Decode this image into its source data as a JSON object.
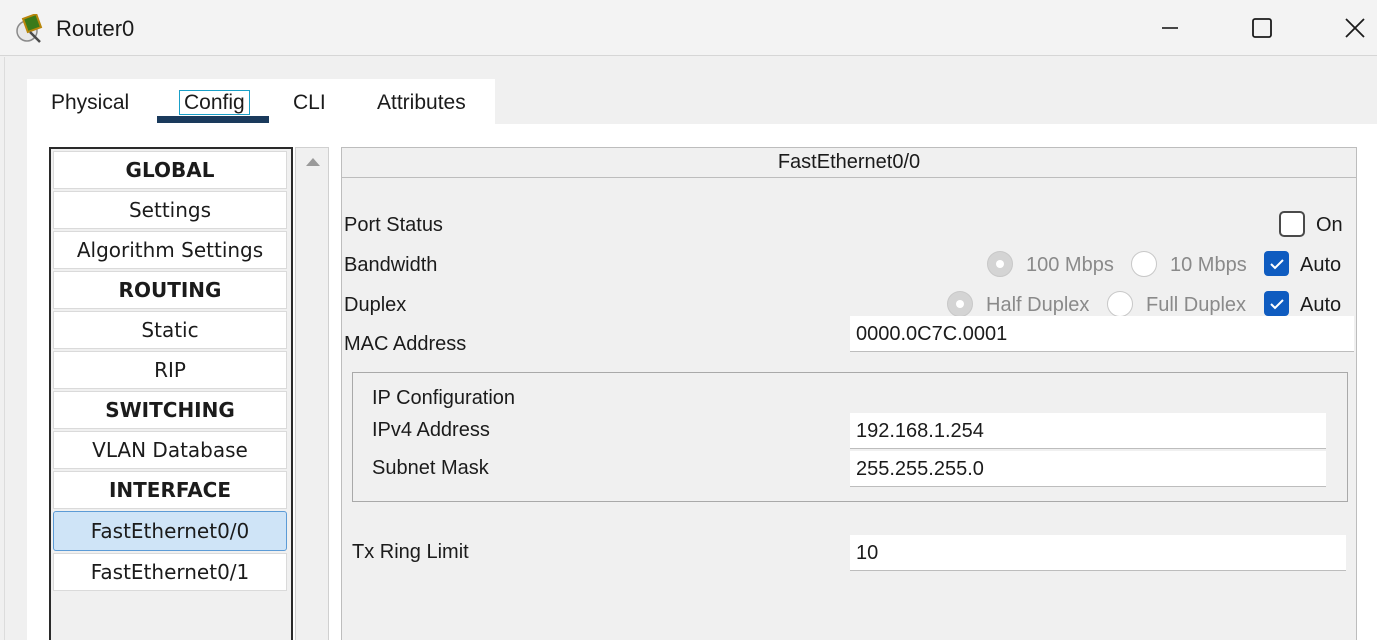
{
  "window": {
    "title": "Router0",
    "icon": "router-icon",
    "controls": [
      "minimize-icon",
      "maximize-icon",
      "close-icon"
    ]
  },
  "tabs": [
    {
      "label": "Physical"
    },
    {
      "label": "Config"
    },
    {
      "label": "CLI"
    },
    {
      "label": "Attributes"
    }
  ],
  "active_tab": "Config",
  "nav": {
    "global_header": "GLOBAL",
    "settings": "Settings",
    "algorithm_settings": "Algorithm Settings",
    "routing_header": "ROUTING",
    "static": "Static",
    "rip": "RIP",
    "switching_header": "SWITCHING",
    "vlan_database": "VLAN Database",
    "interface_header": "INTERFACE",
    "fa00": "FastEthernet0/0",
    "fa01": "FastEthernet0/1"
  },
  "panel": {
    "title": "FastEthernet0/0",
    "port_status": {
      "label": "Port Status",
      "on_label": "On",
      "on": false
    },
    "bandwidth": {
      "label": "Bandwidth",
      "opt_100": "100 Mbps",
      "opt_10": "10 Mbps",
      "auto_label": "Auto",
      "auto": true
    },
    "duplex": {
      "label": "Duplex",
      "opt_half": "Half Duplex",
      "opt_full": "Full Duplex",
      "auto_label": "Auto",
      "auto": true
    },
    "mac": {
      "label": "MAC Address",
      "value": "0000.0C7C.0001"
    },
    "ip_config": {
      "title": "IP Configuration",
      "ipv4_label": "IPv4 Address",
      "ipv4_value": "192.168.1.254",
      "mask_label": "Subnet Mask",
      "mask_value": "255.255.255.0"
    },
    "tx_ring": {
      "label": "Tx Ring Limit",
      "value": "10"
    }
  },
  "colors": {
    "accent": "#0f5cc0",
    "selected": "#cfe4f7",
    "tab_underline": "#1a3a5c"
  }
}
